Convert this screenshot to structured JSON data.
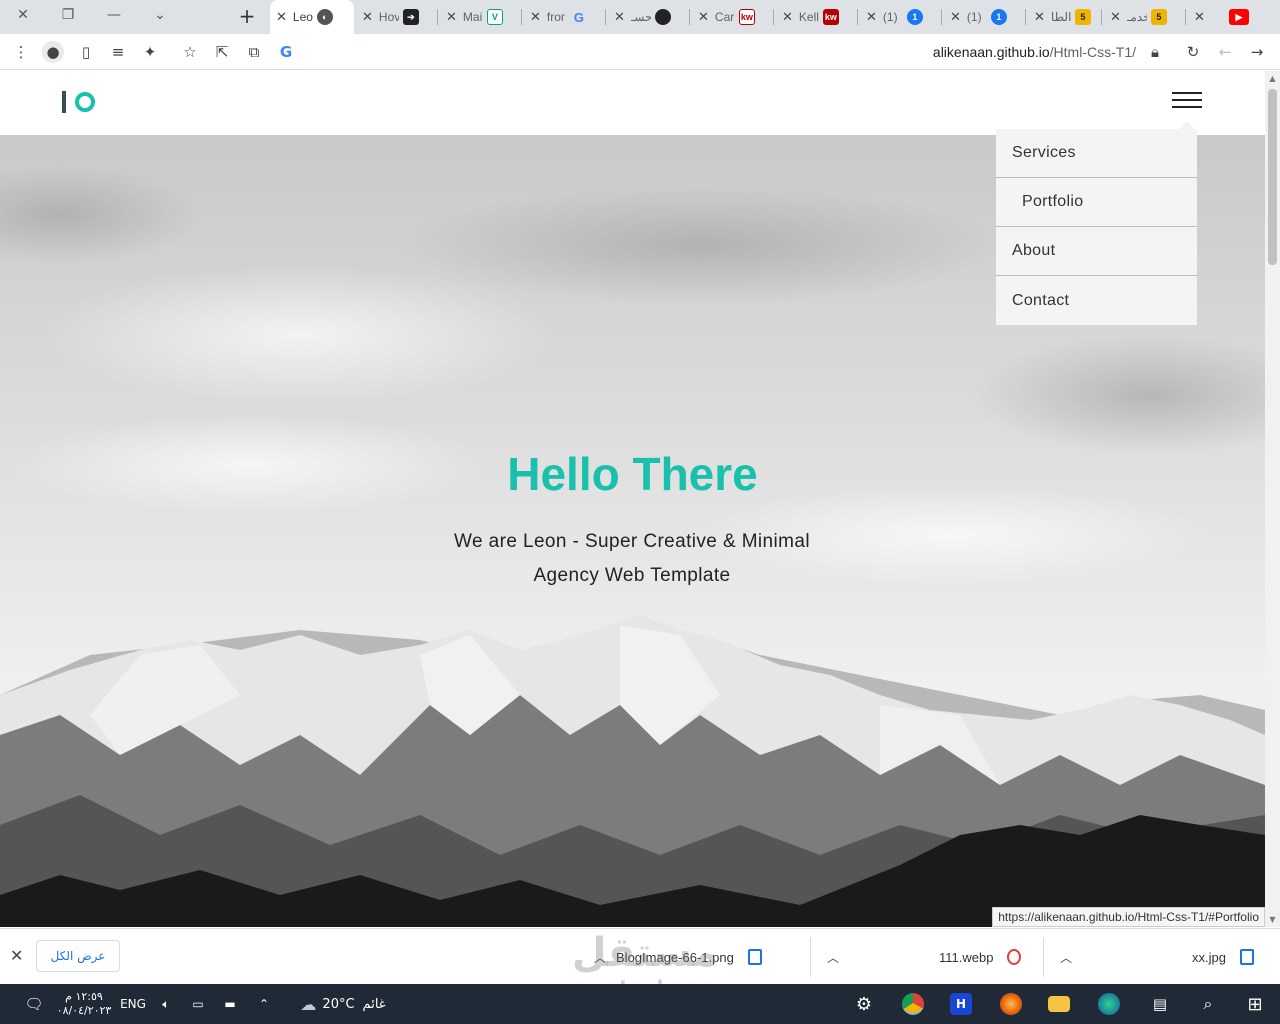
{
  "browser": {
    "window_controls": {
      "close": "✕",
      "restore": "❐",
      "minimize": "—",
      "tablist": "⌄"
    },
    "new_tab": "+",
    "tabs": [
      {
        "title": "Leo",
        "favicon": "globe-icon",
        "active": true
      },
      {
        "title": "Hov",
        "favicon": "arrow-app-icon",
        "active": false
      },
      {
        "title": "Mai",
        "favicon": "v-logo-icon",
        "active": false
      },
      {
        "title": "fror",
        "favicon": "google-icon",
        "active": false
      },
      {
        "title": "حسـ",
        "favicon": "github-icon",
        "active": false
      },
      {
        "title": "Car",
        "favicon": "kw-icon",
        "active": false
      },
      {
        "title": "Kell",
        "favicon": "kw-icon",
        "active": false
      },
      {
        "title": "(1)",
        "favicon": "notification-icon",
        "active": false
      },
      {
        "title": "(1)",
        "favicon": "notification-icon",
        "active": false
      },
      {
        "title": "الطا",
        "favicon": "five-icon",
        "active": false
      },
      {
        "title": "خدمـ",
        "favicon": "five-icon",
        "active": false
      },
      {
        "title": "",
        "favicon": "youtube-icon",
        "active": false
      }
    ],
    "address": {
      "host": "alikenaan.github.io",
      "path": "/Html-Css-T1/"
    },
    "status_url": "https://alikenaan.github.io/Html-Css-T1/#Portfolio"
  },
  "site": {
    "nav": [
      "Services",
      "Portfolio",
      "About",
      "Contact"
    ],
    "hero": {
      "title": "Hello There",
      "subtitle": "We are Leon - Super Creative & Minimal Agency Web Template"
    },
    "accent_color": "#19c1ac"
  },
  "downloads": {
    "show_all": "عرض الكل",
    "items": [
      "BlogImage-66-1.png",
      "111.webp",
      "xx.jpg"
    ]
  },
  "watermark": {
    "arabic": "مستقل",
    "latin": "mostaql.com"
  },
  "taskbar": {
    "time": "١٢:٥٩ م",
    "date": "٠٨/٠٤/٢٠٢٣",
    "language": "ENG",
    "temperature": "20°C",
    "weather": "غائم"
  }
}
